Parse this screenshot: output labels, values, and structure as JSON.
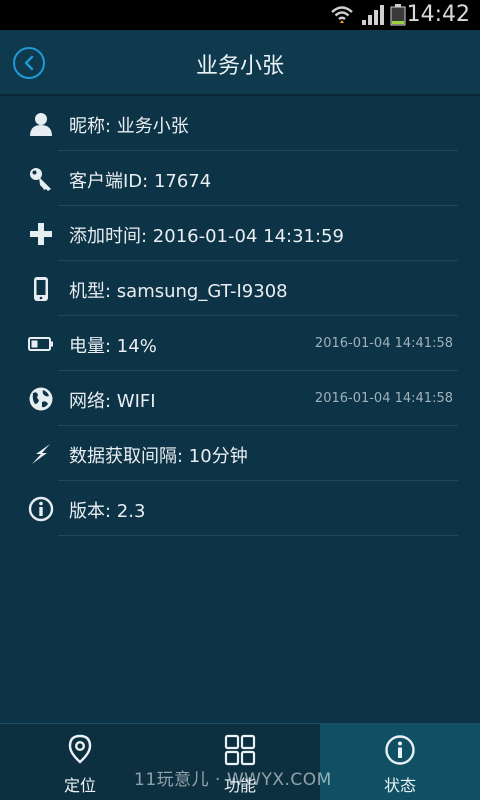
{
  "status_bar": {
    "time": "14:42"
  },
  "header": {
    "title": "业务小张",
    "back_icon": "chevron-left-icon"
  },
  "rows": [
    {
      "id": "nickname",
      "label": "昵称:  业务小张",
      "icon": "user-icon",
      "stamp": ""
    },
    {
      "id": "client-id",
      "label": "客户端ID:  17674",
      "icon": "key-icon",
      "stamp": ""
    },
    {
      "id": "added-time",
      "label": "添加时间:  2016-01-04 14:31:59",
      "icon": "plus-icon",
      "stamp": ""
    },
    {
      "id": "model",
      "label": "机型:  samsung_GT-I9308",
      "icon": "phone-icon",
      "stamp": ""
    },
    {
      "id": "battery",
      "label": "电量:  14%",
      "icon": "battery-icon",
      "stamp": "2016-01-04 14:41:58"
    },
    {
      "id": "network",
      "label": "网络:  WIFI",
      "icon": "globe-icon",
      "stamp": "2016-01-04 14:41:58"
    },
    {
      "id": "interval",
      "label": "数据获取间隔:  10分钟",
      "icon": "lightning-icon",
      "stamp": ""
    },
    {
      "id": "version",
      "label": "版本:  2.3",
      "icon": "info-icon",
      "stamp": ""
    }
  ],
  "bottom_nav": {
    "tabs": [
      {
        "label": "定位",
        "icon": "location-pin-icon",
        "active": false
      },
      {
        "label": "功能",
        "icon": "grid-icon",
        "active": false
      },
      {
        "label": "状态",
        "icon": "info-circle-icon",
        "active": true
      }
    ]
  },
  "watermark": "11玩意儿 · WWYX.COM",
  "colors": {
    "accent": "#1e9ad6",
    "background": "#0d3346",
    "active_tab": "#0f5064"
  }
}
